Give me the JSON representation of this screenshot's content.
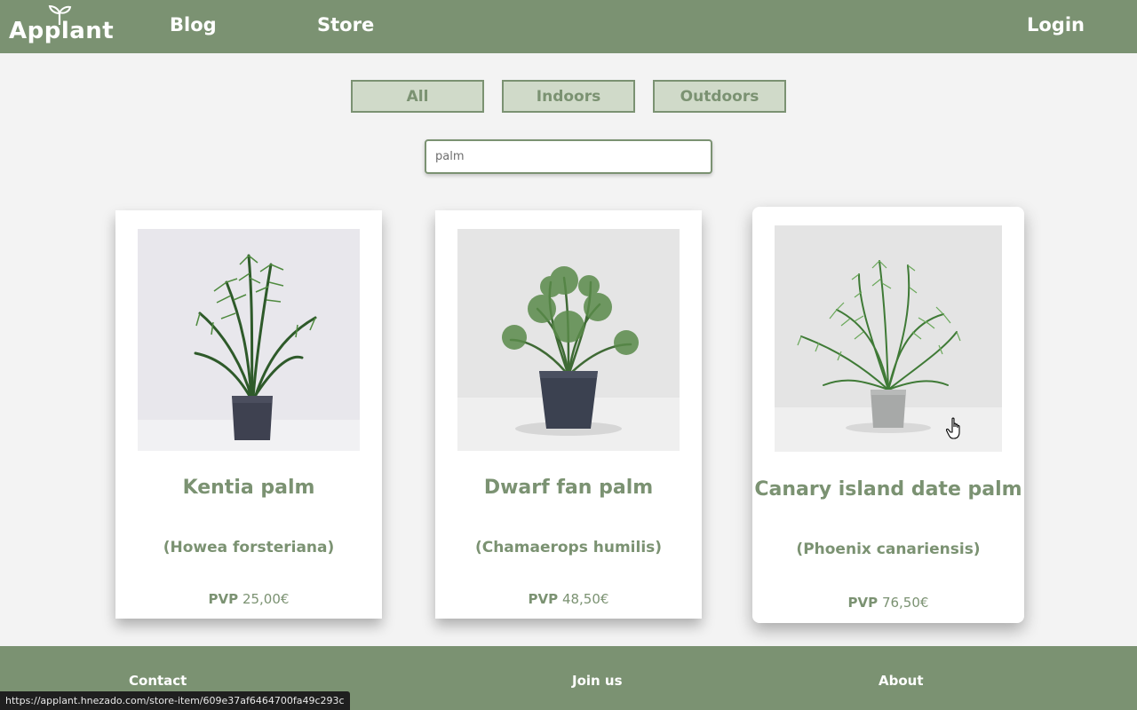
{
  "header": {
    "logo_text": "Applant",
    "nav": {
      "blog": "Blog",
      "store": "Store",
      "login": "Login"
    }
  },
  "filters": {
    "all": "All",
    "indoors": "Indoors",
    "outdoors": "Outdoors"
  },
  "search": {
    "value": "palm"
  },
  "products": [
    {
      "name": "Kentia palm",
      "scientific": "(Howea forsteriana)",
      "price_label": "PVP",
      "price": "25,00€"
    },
    {
      "name": "Dwarf fan palm",
      "scientific": "(Chamaerops humilis)",
      "price_label": "PVP",
      "price": "48,50€"
    },
    {
      "name": "Canary island date palm",
      "scientific": "(Phoenix canariensis)",
      "price_label": "PVP",
      "price": "76,50€"
    }
  ],
  "footer": {
    "contact": "Contact",
    "join": "Join us",
    "about": "About"
  },
  "status_url": "https://applant.hnezado.com/store-item/609e37af6464700fa49c293c",
  "colors": {
    "brand": "#7b9272",
    "filter_bg": "#d0dac9",
    "background": "#f3f3f3"
  }
}
